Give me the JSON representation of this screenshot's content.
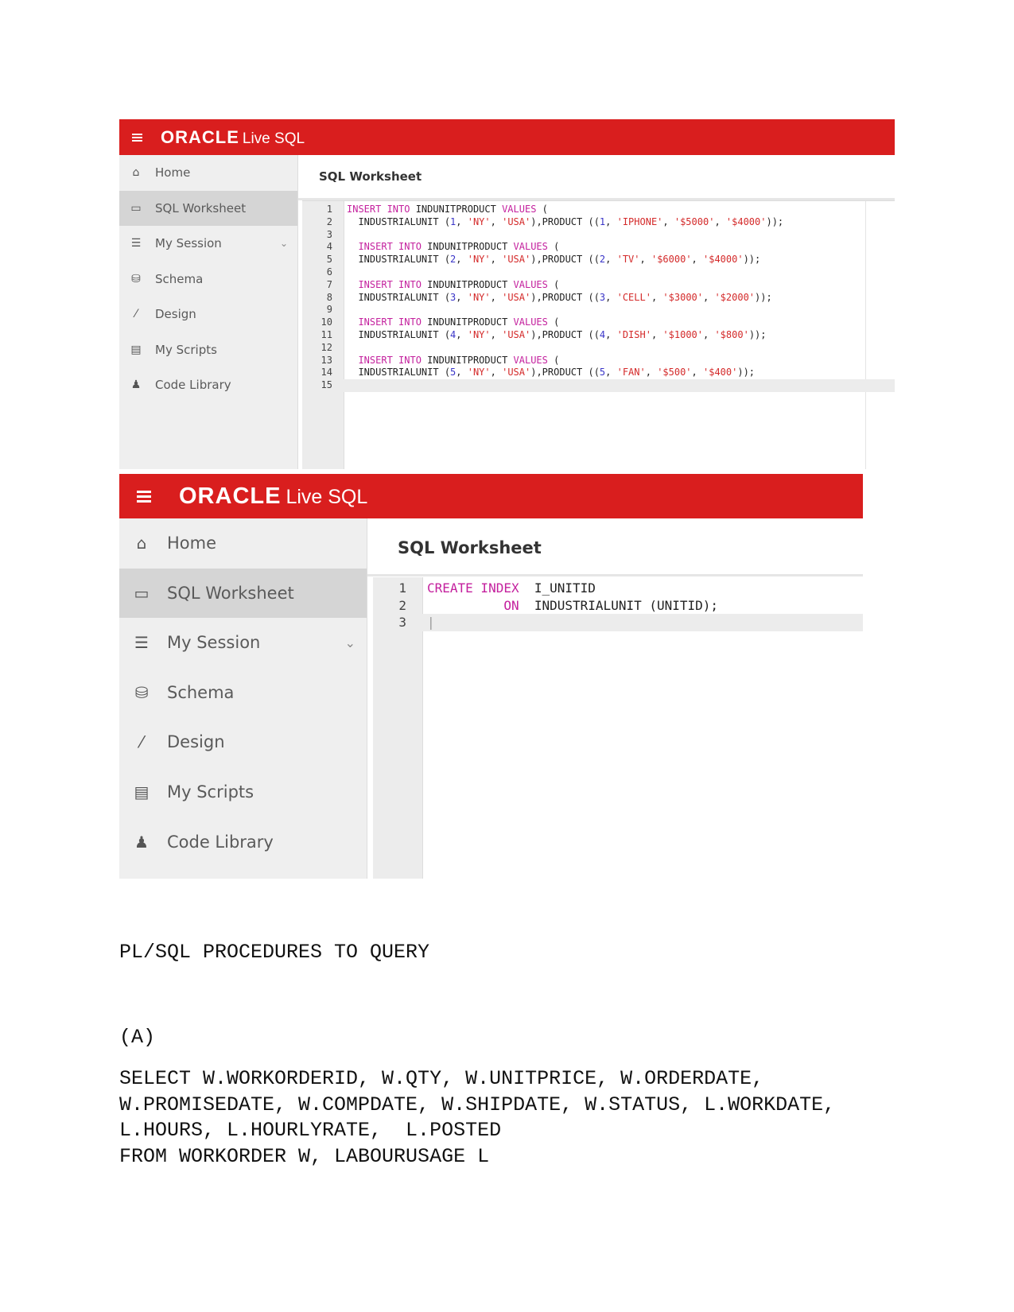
{
  "colors": {
    "header": "#d91e1e",
    "keyword": "#c4219e",
    "string": "#d42a2a",
    "number": "#3a35c8"
  },
  "app": {
    "logo": "ORACLE",
    "logo_suffix": "Live SQL"
  },
  "sidebar": {
    "items": [
      {
        "label": "Home",
        "icon": "home-icon"
      },
      {
        "label": "SQL Worksheet",
        "icon": "monitor-icon",
        "active": true
      },
      {
        "label": "My Session",
        "icon": "list-icon",
        "chevron": true
      },
      {
        "label": "Schema",
        "icon": "database-icon"
      },
      {
        "label": "Design",
        "icon": "wand-icon"
      },
      {
        "label": "My Scripts",
        "icon": "document-icon"
      },
      {
        "label": "Code Library",
        "icon": "users-icon"
      }
    ]
  },
  "worksheet_title": "SQL Worksheet",
  "editor1": {
    "current_line": 15,
    "lines": [
      [
        [
          "kw",
          "INSERT INTO"
        ],
        [
          "p",
          " INDUNITPRODUCT "
        ],
        [
          "kw",
          "VALUES"
        ],
        [
          "p",
          " ("
        ]
      ],
      [
        [
          "p",
          "  INDUSTRIALUNIT ("
        ],
        [
          "num",
          "1"
        ],
        [
          "p",
          ", "
        ],
        [
          "str",
          "'NY'"
        ],
        [
          "p",
          ", "
        ],
        [
          "str",
          "'USA'"
        ],
        [
          "p",
          "),PRODUCT (("
        ],
        [
          "num",
          "1"
        ],
        [
          "p",
          ", "
        ],
        [
          "str",
          "'IPHONE'"
        ],
        [
          "p",
          ", "
        ],
        [
          "str",
          "'$5000'"
        ],
        [
          "p",
          ", "
        ],
        [
          "str",
          "'$4000'"
        ],
        [
          "p",
          "));"
        ]
      ],
      [],
      [
        [
          "p",
          "  "
        ],
        [
          "kw",
          "INSERT INTO"
        ],
        [
          "p",
          " INDUNITPRODUCT "
        ],
        [
          "kw",
          "VALUES"
        ],
        [
          "p",
          " ("
        ]
      ],
      [
        [
          "p",
          "  INDUSTRIALUNIT ("
        ],
        [
          "num",
          "2"
        ],
        [
          "p",
          ", "
        ],
        [
          "str",
          "'NY'"
        ],
        [
          "p",
          ", "
        ],
        [
          "str",
          "'USA'"
        ],
        [
          "p",
          "),PRODUCT (("
        ],
        [
          "num",
          "2"
        ],
        [
          "p",
          ", "
        ],
        [
          "str",
          "'TV'"
        ],
        [
          "p",
          ", "
        ],
        [
          "str",
          "'$6000'"
        ],
        [
          "p",
          ", "
        ],
        [
          "str",
          "'$4000'"
        ],
        [
          "p",
          "));"
        ]
      ],
      [],
      [
        [
          "p",
          "  "
        ],
        [
          "kw",
          "INSERT INTO"
        ],
        [
          "p",
          " INDUNITPRODUCT "
        ],
        [
          "kw",
          "VALUES"
        ],
        [
          "p",
          " ("
        ]
      ],
      [
        [
          "p",
          "  INDUSTRIALUNIT ("
        ],
        [
          "num",
          "3"
        ],
        [
          "p",
          ", "
        ],
        [
          "str",
          "'NY'"
        ],
        [
          "p",
          ", "
        ],
        [
          "str",
          "'USA'"
        ],
        [
          "p",
          "),PRODUCT (("
        ],
        [
          "num",
          "3"
        ],
        [
          "p",
          ", "
        ],
        [
          "str",
          "'CELL'"
        ],
        [
          "p",
          ", "
        ],
        [
          "str",
          "'$3000'"
        ],
        [
          "p",
          ", "
        ],
        [
          "str",
          "'$2000'"
        ],
        [
          "p",
          "));"
        ]
      ],
      [],
      [
        [
          "p",
          "  "
        ],
        [
          "kw",
          "INSERT INTO"
        ],
        [
          "p",
          " INDUNITPRODUCT "
        ],
        [
          "kw",
          "VALUES"
        ],
        [
          "p",
          " ("
        ]
      ],
      [
        [
          "p",
          "  INDUSTRIALUNIT ("
        ],
        [
          "num",
          "4"
        ],
        [
          "p",
          ", "
        ],
        [
          "str",
          "'NY'"
        ],
        [
          "p",
          ", "
        ],
        [
          "str",
          "'USA'"
        ],
        [
          "p",
          "),PRODUCT (("
        ],
        [
          "num",
          "4"
        ],
        [
          "p",
          ", "
        ],
        [
          "str",
          "'DISH'"
        ],
        [
          "p",
          ", "
        ],
        [
          "str",
          "'$1000'"
        ],
        [
          "p",
          ", "
        ],
        [
          "str",
          "'$800'"
        ],
        [
          "p",
          "));"
        ]
      ],
      [],
      [
        [
          "p",
          "  "
        ],
        [
          "kw",
          "INSERT INTO"
        ],
        [
          "p",
          " INDUNITPRODUCT "
        ],
        [
          "kw",
          "VALUES"
        ],
        [
          "p",
          " ("
        ]
      ],
      [
        [
          "p",
          "  INDUSTRIALUNIT ("
        ],
        [
          "num",
          "5"
        ],
        [
          "p",
          ", "
        ],
        [
          "str",
          "'NY'"
        ],
        [
          "p",
          ", "
        ],
        [
          "str",
          "'USA'"
        ],
        [
          "p",
          "),PRODUCT (("
        ],
        [
          "num",
          "5"
        ],
        [
          "p",
          ", "
        ],
        [
          "str",
          "'FAN'"
        ],
        [
          "p",
          ", "
        ],
        [
          "str",
          "'$500'"
        ],
        [
          "p",
          ", "
        ],
        [
          "str",
          "'$400'"
        ],
        [
          "p",
          "));"
        ]
      ],
      []
    ]
  },
  "editor2": {
    "current_line": 3,
    "lines": [
      [
        [
          "kw",
          "CREATE INDEX"
        ],
        [
          "p",
          "  I_UNITID"
        ]
      ],
      [
        [
          "p",
          "          "
        ],
        [
          "kw",
          "ON"
        ],
        [
          "p",
          "  INDUSTRIALUNIT (UNITID);"
        ]
      ],
      []
    ]
  },
  "document": {
    "heading": "PL/SQL PROCEDURES TO QUERY",
    "label": "(A)",
    "sql_lines": [
      "SELECT W.WORKORDERID, W.QTY, W.UNITPRICE, W.ORDERDATE,",
      "W.PROMISEDATE, W.COMPDATE, W.SHIPDATE, W.STATUS, L.WORKDATE,",
      "L.HOURS, L.HOURLYRATE,  L.POSTED",
      "FROM WORKORDER W, LABOURUSAGE L"
    ]
  }
}
